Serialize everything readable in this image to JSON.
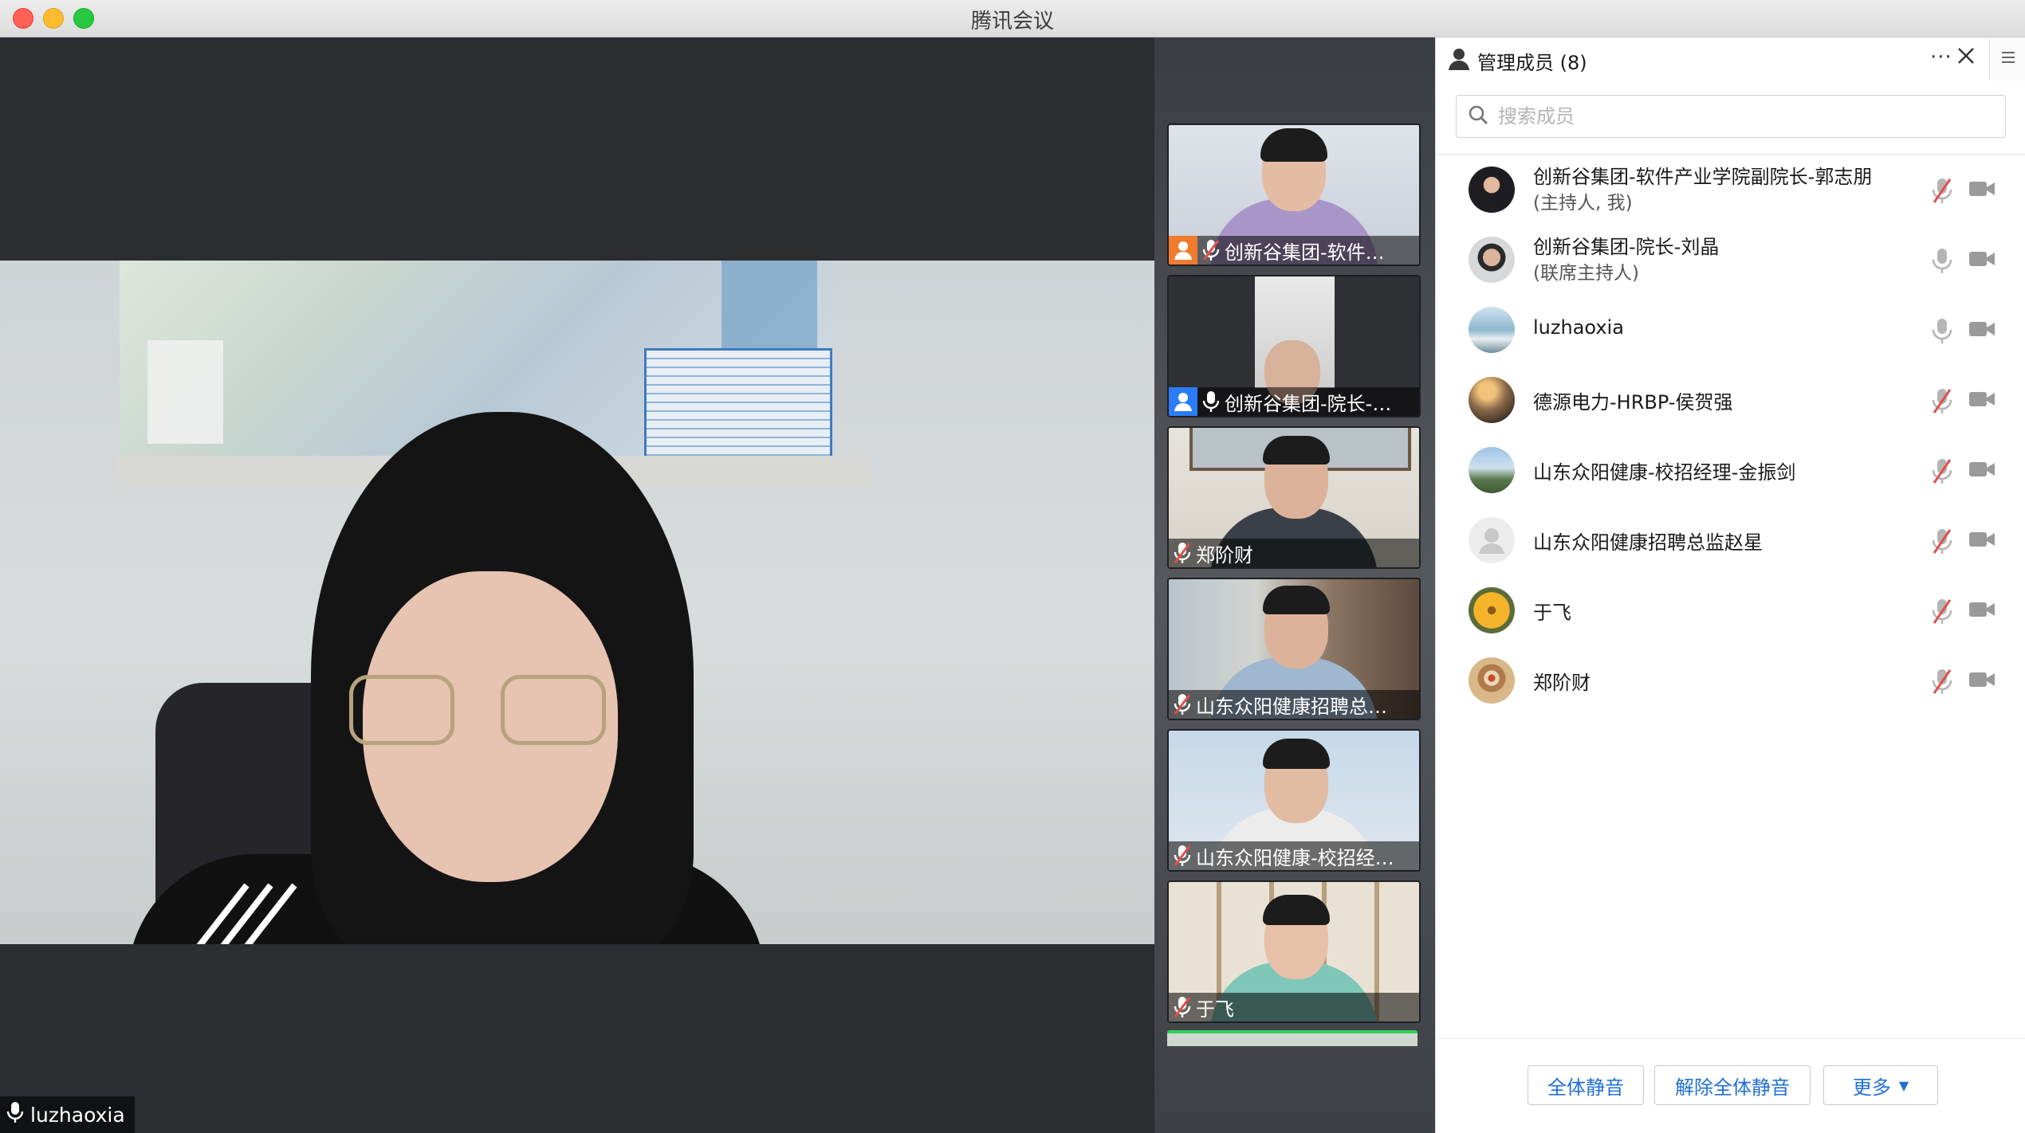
{
  "window": {
    "title": "腾讯会议"
  },
  "main_video": {
    "name": "luzhaoxia"
  },
  "thumbnails": [
    {
      "label": "创新谷集团-软件…",
      "role": "host"
    },
    {
      "label": "创新谷集团-院长-…",
      "role": "cohost"
    },
    {
      "label": "郑阶财",
      "role": ""
    },
    {
      "label": "山东众阳健康招聘总…",
      "role": ""
    },
    {
      "label": "山东众阳健康-校招经…",
      "role": ""
    },
    {
      "label": "于飞",
      "role": ""
    }
  ],
  "panel": {
    "title": "管理成员 (8)",
    "more": "···",
    "search_placeholder": "搜索成员",
    "members": [
      {
        "name": "创新谷集团-软件产业学院副院长-郭志朋",
        "sub": "(主持人, 我)",
        "mic": "muted",
        "camera": "on"
      },
      {
        "name": "创新谷集团-院长-刘晶",
        "sub": "(联席主持人)",
        "mic": "on",
        "camera": "on"
      },
      {
        "name": "luzhaoxia",
        "sub": "",
        "mic": "on",
        "camera": "on"
      },
      {
        "name": "德源电力-HRBP-侯贺强",
        "sub": "",
        "mic": "muted",
        "camera": "on"
      },
      {
        "name": "山东众阳健康-校招经理-金振剑",
        "sub": "",
        "mic": "muted",
        "camera": "on"
      },
      {
        "name": "山东众阳健康招聘总监赵星",
        "sub": "",
        "mic": "muted",
        "camera": "on"
      },
      {
        "name": "于飞",
        "sub": "",
        "mic": "muted",
        "camera": "on"
      },
      {
        "name": "郑阶财",
        "sub": "",
        "mic": "muted",
        "camera": "on"
      }
    ],
    "buttons": {
      "mute_all": "全体静音",
      "unmute_all": "解除全体静音",
      "more": "更多"
    }
  },
  "colors": {
    "accent": "#1f6fd6",
    "muted_mic": "#e0504a",
    "host_badge": "#f07a2e",
    "cohost_badge": "#2b7cf6",
    "active_speaker": "#2fd158"
  }
}
